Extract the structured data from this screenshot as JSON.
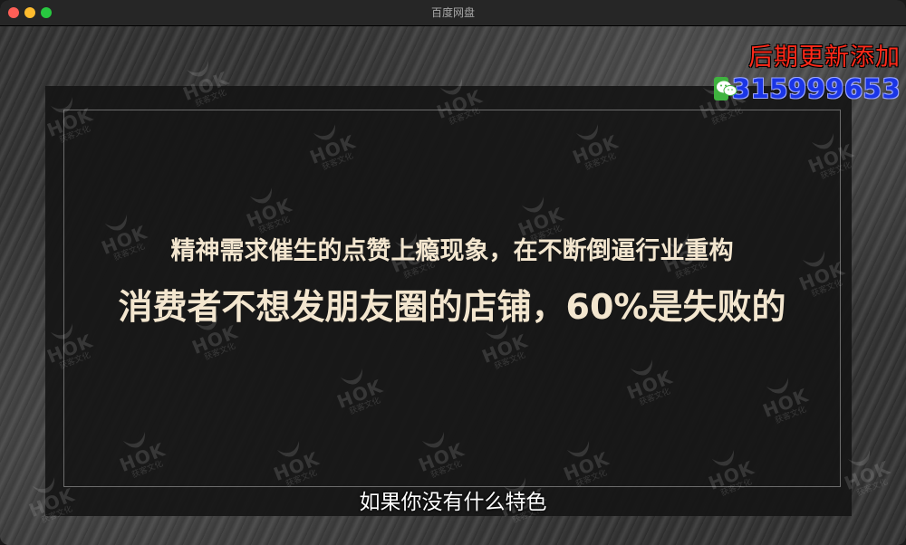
{
  "window": {
    "title": "百度网盘"
  },
  "slide": {
    "headline_line1": "精神需求催生的点赞上瘾现象，在不断倒逼行业重构",
    "headline_line2": "消费者不想发朋友圈的店铺，60%是失败的",
    "watermark_text": "HOK",
    "watermark_sub": "获客文化"
  },
  "subtitle": {
    "text": "如果你没有什么特色"
  },
  "promo": {
    "line1": "后期更新添加",
    "wechat_number": "315999653",
    "icon": "wechat-icon"
  },
  "colors": {
    "headline": "#f3e6cf",
    "promo_red": "#ff2a1a",
    "promo_blue": "#1a35e6",
    "wechat_green": "#3fb33f"
  }
}
